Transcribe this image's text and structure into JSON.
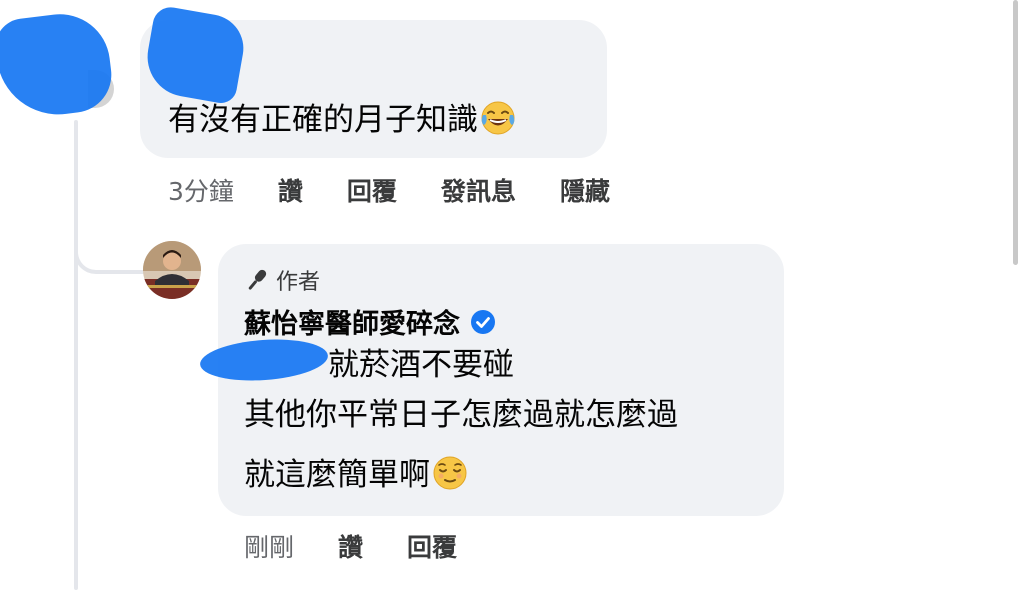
{
  "comment": {
    "text": "有沒有正確的月子知識",
    "emoji": "joy-tears-emoji",
    "time": "3分鐘",
    "actions": [
      "讚",
      "回覆",
      "發訊息",
      "隱藏"
    ]
  },
  "reply": {
    "badge": "作者",
    "author": "蘇怡寧醫師愛碎念",
    "verified": true,
    "lines": [
      "就菸酒不要碰",
      "其他你平常日子怎麼過就怎麼過",
      "就這麼簡單啊"
    ],
    "emoji": "relieved-face-emoji",
    "time": "剛剛",
    "actions": [
      "讚",
      "回覆"
    ]
  },
  "colors": {
    "bubble": "#f0f2f5",
    "verified": "#1877f2",
    "redaction": "#1877f2",
    "secondary_text": "#65676b"
  }
}
